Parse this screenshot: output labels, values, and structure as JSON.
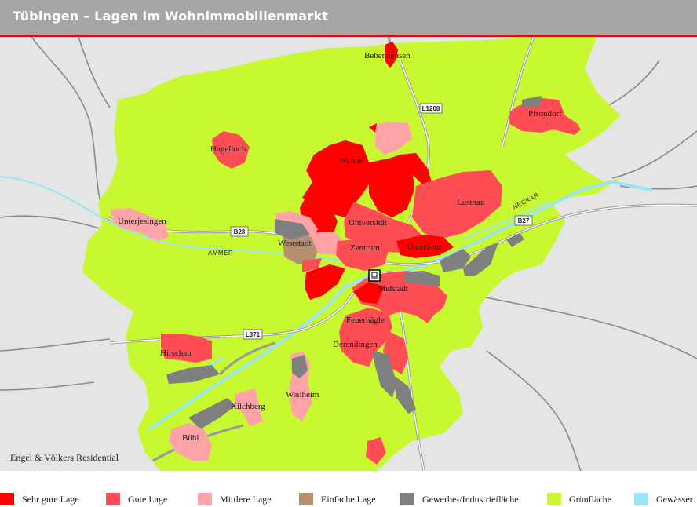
{
  "title": "Tübingen – Lagen im Wohnimmobilienmarkt",
  "credit": "Engel & Völkers Residential",
  "colors": {
    "sehr_gut": "#ff0000",
    "gut": "#ff4d55",
    "mittel": "#ffa3a6",
    "einfach": "#b5906e",
    "gewerbe": "#7f7f7f",
    "gruen": "#c8f930",
    "wasser": "#99e5f5",
    "background": "#e5e5e5",
    "roads": "#8a8a8a",
    "header": "#a6a6a6",
    "accent": "#e3001b"
  },
  "places": {
    "bebenhausen": "Bebenhausen",
    "pfrondorf": "Pfrondorf",
    "hagelloch": "Hagelloch",
    "wanne": "Wanne",
    "lustnau": "Lustnau",
    "unterjesingen": "Unterjesingen",
    "universitaet": "Universität",
    "weststadt": "Weststadt",
    "zentrum": "Zentrum",
    "oesterberg": "Österberg",
    "suedstadt": "Südstadt",
    "feuerhaegle": "Feuerhägle",
    "derendingen": "Derendingen",
    "hirschau": "Hirschau",
    "weilheim": "Weilheim",
    "kilchberg": "Kilchberg",
    "buehl": "Bühl"
  },
  "roads": {
    "l1208": "L1208",
    "b28": "B28",
    "b27": "B27",
    "l371": "L371"
  },
  "rivers": {
    "ammer": "AMMER",
    "neckar": "NECKAR"
  },
  "legend": [
    {
      "label": "Sehr gute Lage",
      "color": "#ff0000"
    },
    {
      "label": "Gute Lage",
      "color": "#ff4d55"
    },
    {
      "label": "Mittlere Lage",
      "color": "#ffa3a6"
    },
    {
      "label": "Einfache Lage",
      "color": "#b5906e"
    },
    {
      "label": "Gewerbe-/Industriefläche",
      "color": "#7f7f7f"
    },
    {
      "label": "Grünfläche",
      "color": "#c8f930"
    },
    {
      "label": "Gewässer",
      "color": "#99e5f5"
    }
  ]
}
